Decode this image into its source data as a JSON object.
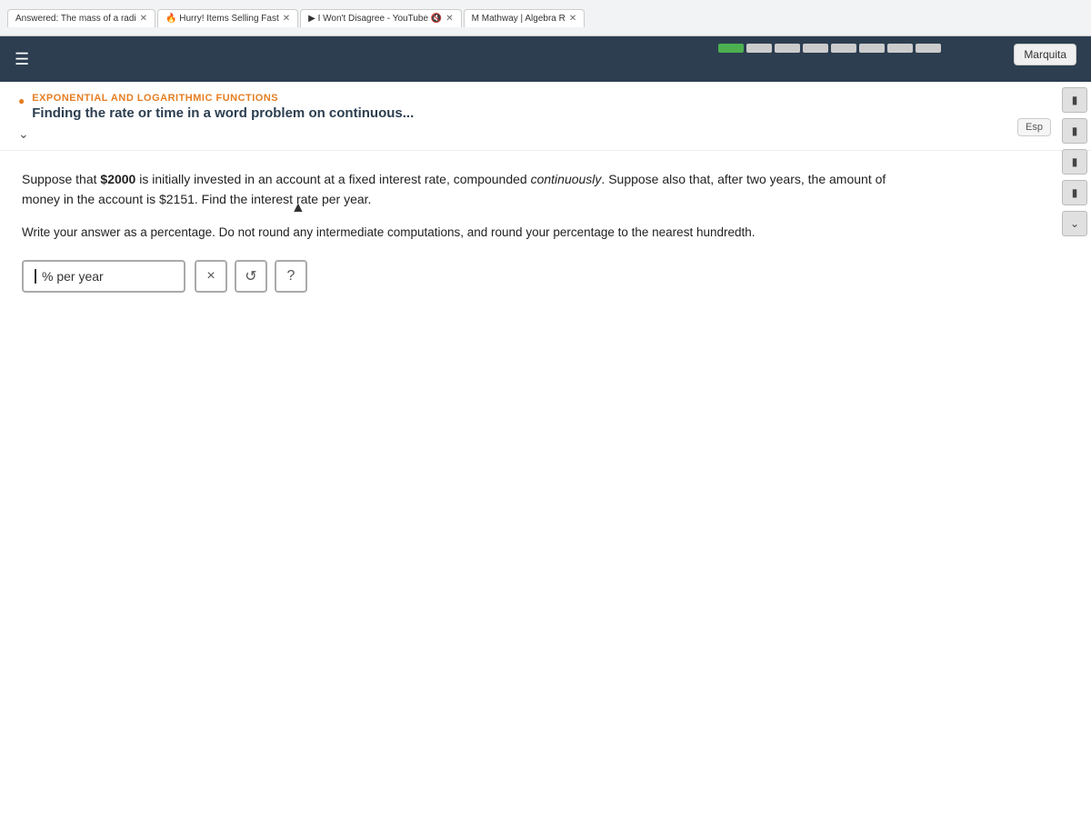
{
  "browser": {
    "tabs": [
      {
        "id": "tab1",
        "label": "Answered: The mass of a radi",
        "active": false
      },
      {
        "id": "tab2",
        "label": "Hurry! Items Selling Fast",
        "active": false
      },
      {
        "id": "tab3",
        "label": "I Won't Disagree - YouTube",
        "active": false
      },
      {
        "id": "tab4",
        "label": "Mathway | Algebra R",
        "active": false
      }
    ],
    "url": "ekscgi/x/lsl.exe/1o_u-lgNslkasNW8D8A9PVVROTuRTtuFljpdgJ2gz8nsHUvStcj_d129IDimlpv7Rl8tHEOTCk5zqCmqnsVtTxSL06oAP7EtF0SOEZr4Cg89lmBu4k4Axtq?1oBw7QYjlbavbSPXtx-YCjsh_7mMmrqAtr"
  },
  "nav": {
    "hamburger_label": "☰",
    "logo": ""
  },
  "progress": {
    "segments": [
      1,
      0,
      0,
      0,
      0,
      0,
      0,
      0
    ],
    "filled_color": "#4caf50",
    "empty_color": "#cccccc"
  },
  "user_badge": {
    "label": "Marquita"
  },
  "section": {
    "label": "EXPONENTIAL AND LOGARITHMIC FUNCTIONS",
    "title": "Finding the rate or time in a word problem on continuous..."
  },
  "problem": {
    "text_parts": [
      {
        "type": "normal",
        "text": "Suppose that "
      },
      {
        "type": "bold",
        "text": "$2000"
      },
      {
        "type": "normal",
        "text": " is initially invested in an account at a fixed interest rate, compounded "
      },
      {
        "type": "italic",
        "text": "continuously"
      },
      {
        "type": "normal",
        "text": ". Suppose also that, after two years, the amount of"
      }
    ],
    "line2": "money in the account is $2151. Find the interest rate per year.",
    "instruction": "Write your answer as a percentage. Do not round any intermediate computations, and round your percentage to the nearest hundredth."
  },
  "answer": {
    "input_value": "",
    "unit_label": "% per year",
    "placeholder": ""
  },
  "buttons": {
    "clear_label": "×",
    "refresh_label": "↺",
    "help_label": "?"
  },
  "esp_badge": "Esp",
  "right_icons": [
    "📋",
    "📄",
    "🔤",
    "✉"
  ]
}
